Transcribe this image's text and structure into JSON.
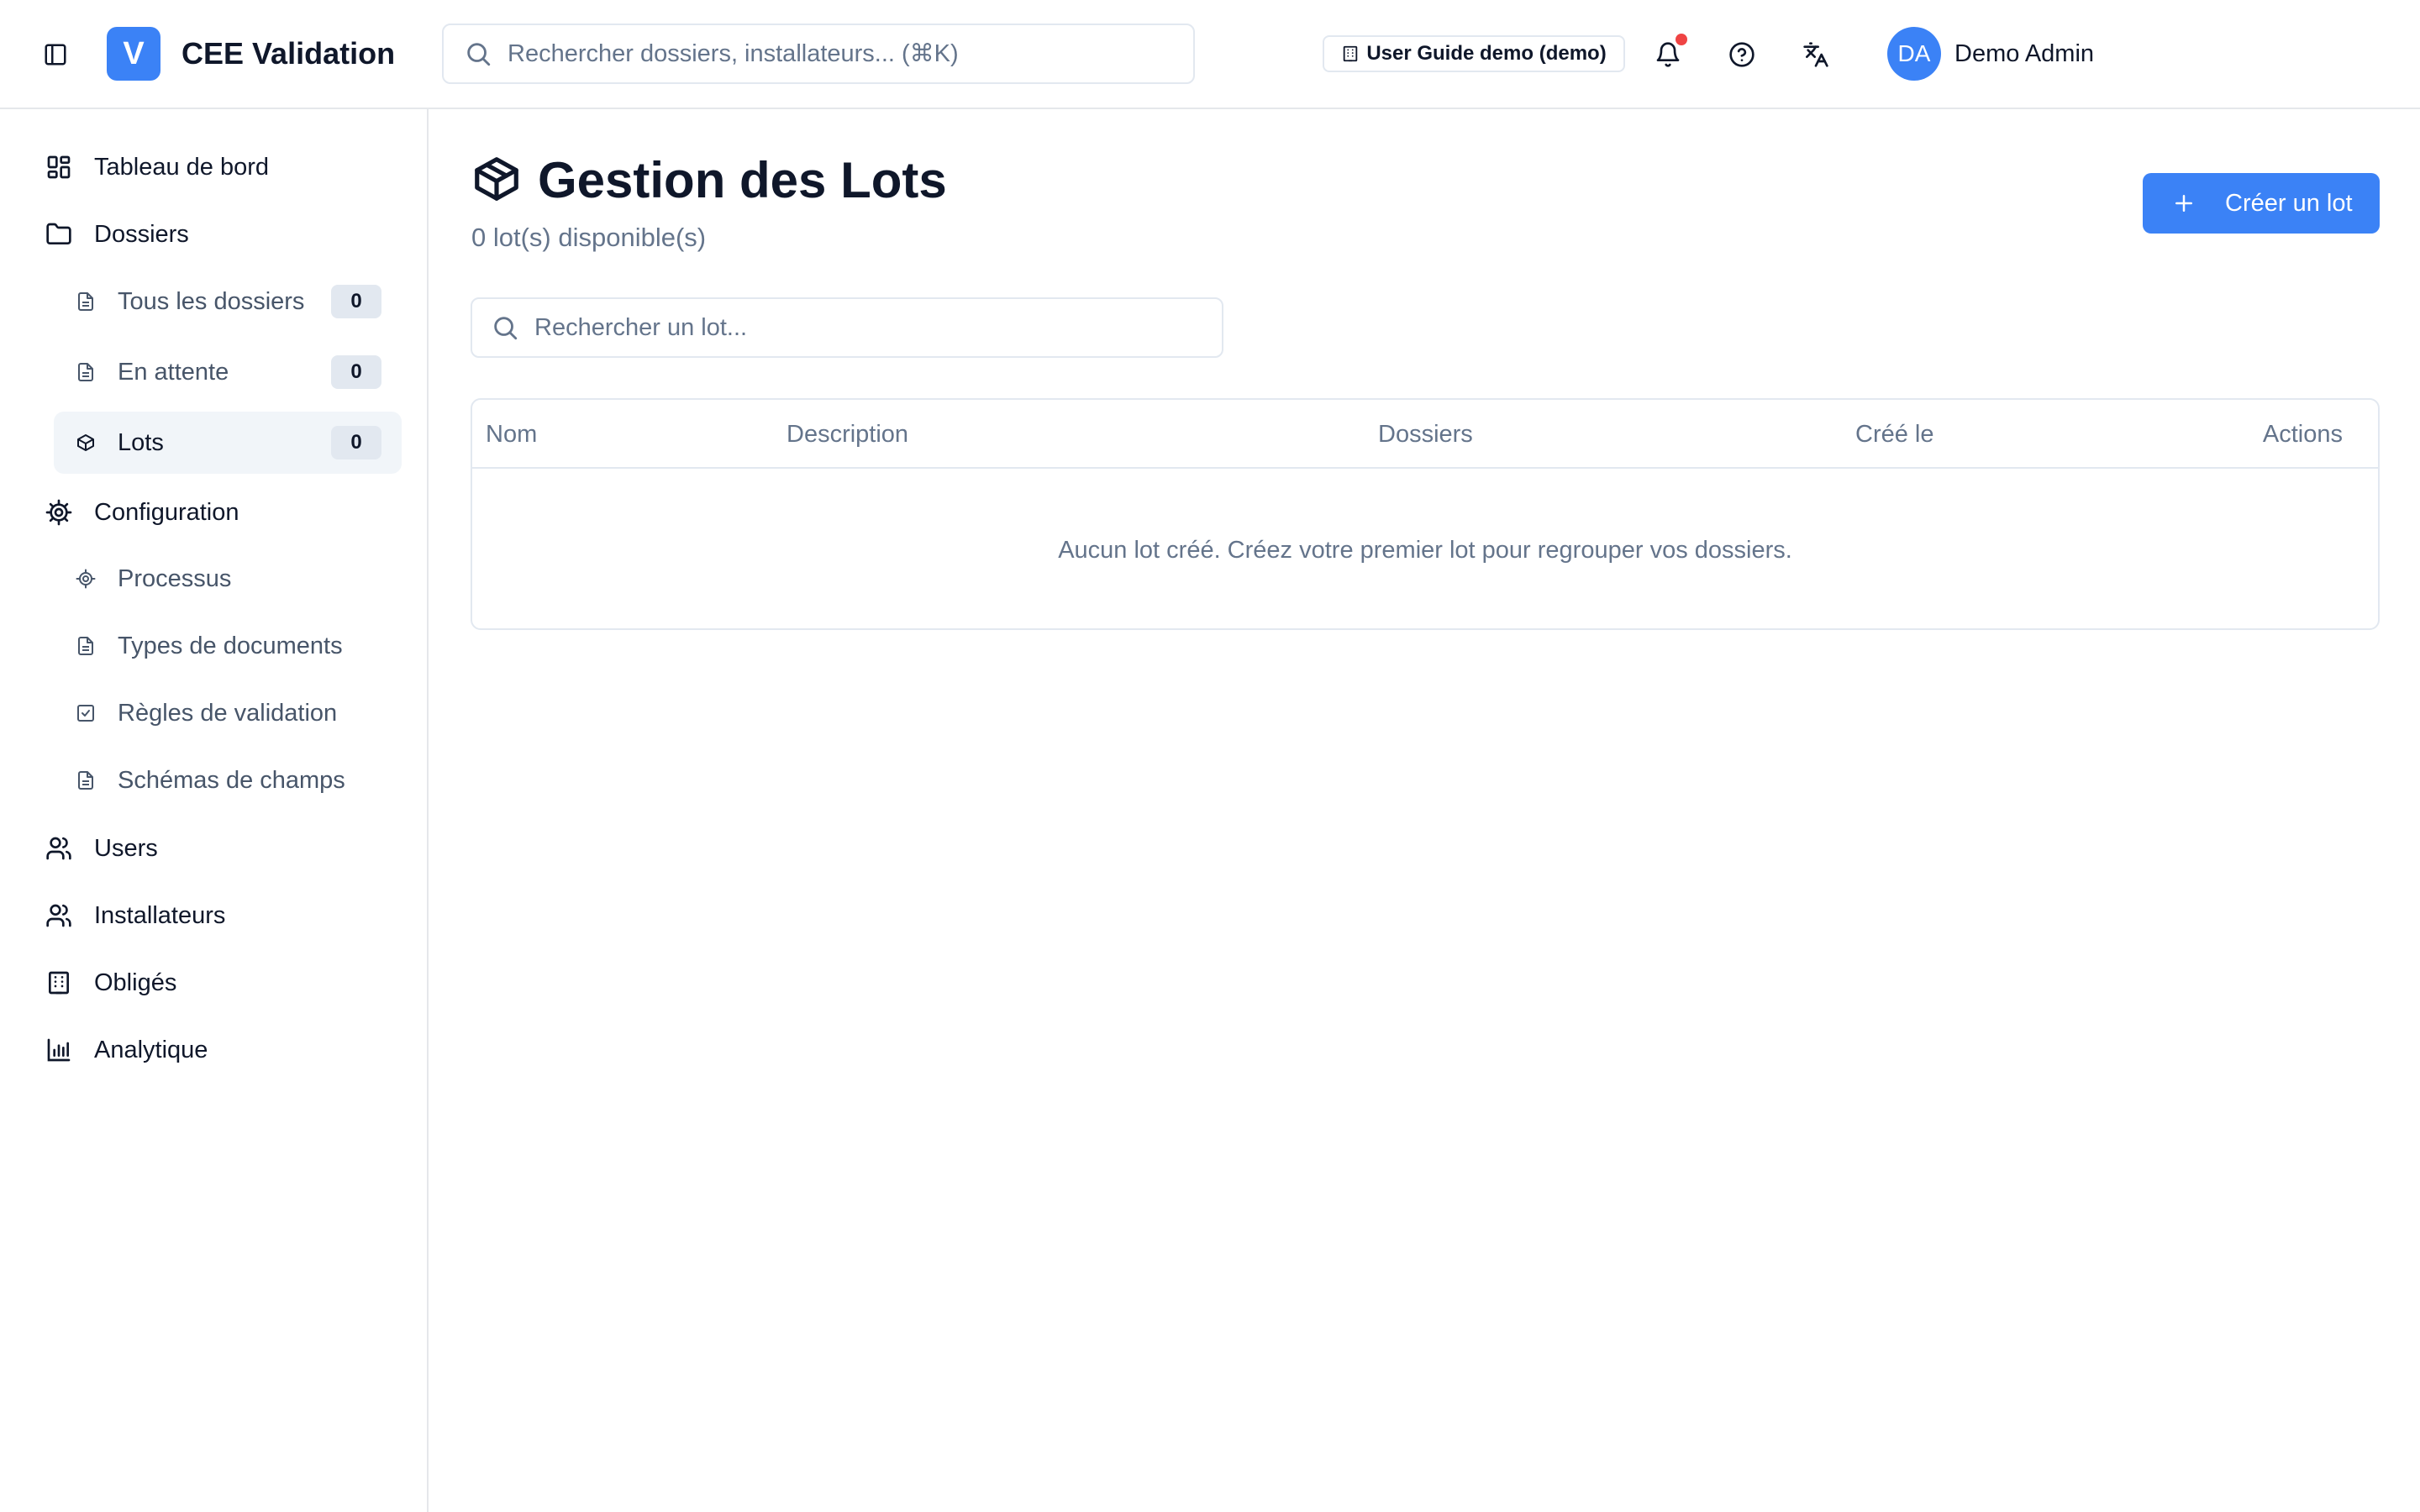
{
  "header": {
    "logo_letter": "V",
    "app_title": "CEE Validation",
    "search_placeholder": "Rechercher dossiers, installateurs... (⌘K)",
    "tenant_badge": "User Guide demo (demo)",
    "user_initials": "DA",
    "user_name": "Demo Admin",
    "icons": [
      "sidebar-toggle-icon",
      "search-icon",
      "building-icon",
      "bell-icon",
      "help-circle-icon",
      "translate-icon"
    ],
    "colors": {
      "accent": "#3b82f6",
      "notification": "#ef4444"
    }
  },
  "sidebar": {
    "items": [
      {
        "label": "Tableau de bord",
        "icon": "dashboard-icon"
      },
      {
        "label": "Dossiers",
        "icon": "folder-icon"
      },
      {
        "label": "Tous les dossiers",
        "icon": "file-icon",
        "count": "0"
      },
      {
        "label": "En attente",
        "icon": "file-icon",
        "count": "0"
      },
      {
        "label": "Lots",
        "icon": "package-icon",
        "count": "0",
        "active": true
      },
      {
        "label": "Configuration",
        "icon": "gear-icon"
      },
      {
        "label": "Processus",
        "icon": "gear-icon"
      },
      {
        "label": "Types de documents",
        "icon": "file-icon"
      },
      {
        "label": "Règles de validation",
        "icon": "check-square-icon"
      },
      {
        "label": "Schémas de champs",
        "icon": "file-icon"
      },
      {
        "label": "Users",
        "icon": "users-icon"
      },
      {
        "label": "Installateurs",
        "icon": "users-icon"
      },
      {
        "label": "Obligés",
        "icon": "building-icon"
      },
      {
        "label": "Analytique",
        "icon": "bar-chart-icon"
      }
    ]
  },
  "main": {
    "title": "Gestion des Lots",
    "subtitle": "0 lot(s) disponible(s)",
    "create_button": "Créer un lot",
    "search_placeholder": "Rechercher un lot...",
    "table": {
      "columns": [
        "Nom",
        "Description",
        "Dossiers",
        "Créé le",
        "Actions"
      ],
      "rows": [],
      "empty_message": "Aucun lot créé. Créez votre premier lot pour regrouper vos dossiers."
    }
  }
}
